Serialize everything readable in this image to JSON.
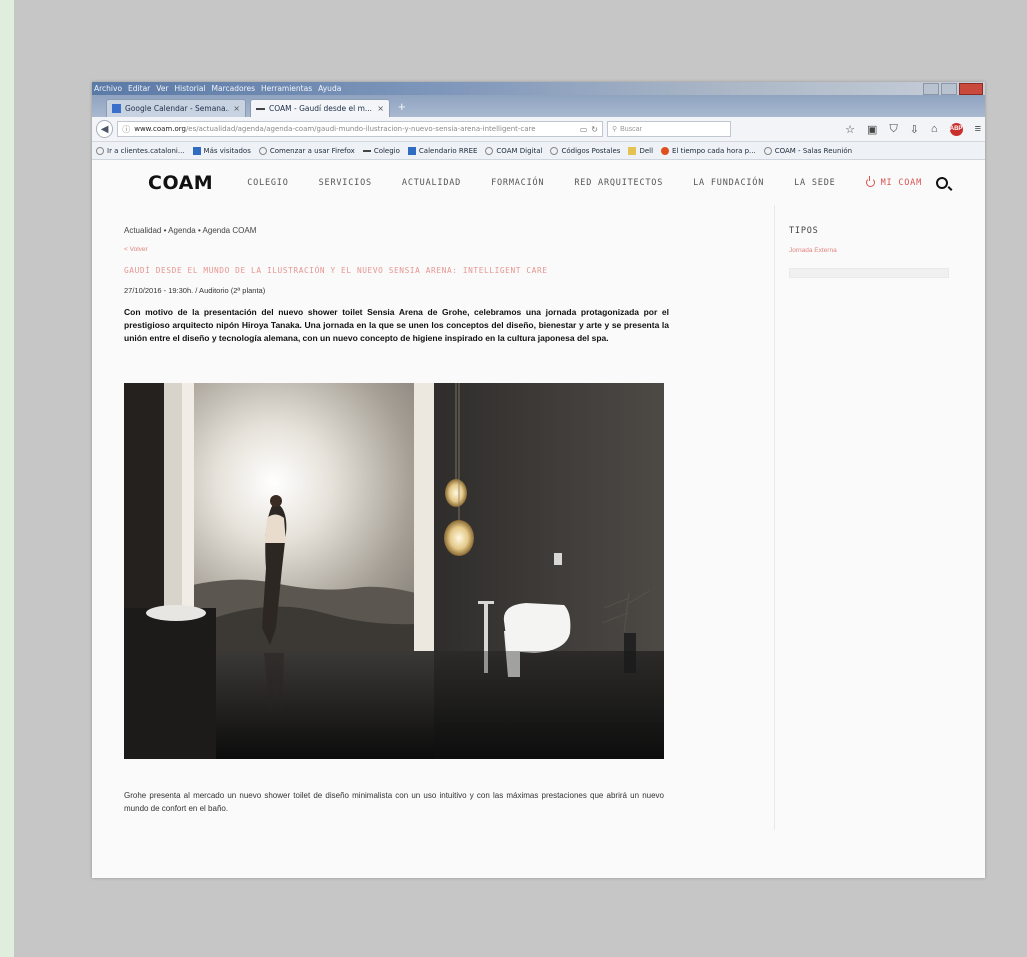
{
  "browser": {
    "menu": [
      "Archivo",
      "Editar",
      "Ver",
      "Historial",
      "Marcadores",
      "Herramientas",
      "Ayuda"
    ],
    "tabs": [
      {
        "label": "Google Calendar - Semana...",
        "active": false
      },
      {
        "label": "COAM - Gaudí desde el m...",
        "active": true
      }
    ],
    "new_tab": "+",
    "url_domain": "www.coam.org",
    "url_path": "/es/actualidad/agenda/agenda-coam/gaudi-mundo-ilustracion-y-nuevo-sensia-arena-intelligent-care",
    "search_placeholder": "Buscar",
    "bookmarks": [
      {
        "label": "Ir a clientes.cataloni...",
        "icon": "globe"
      },
      {
        "label": "Más visitados",
        "icon": "folder-blue"
      },
      {
        "label": "Comenzar a usar Firefox",
        "icon": "globe"
      },
      {
        "label": "Colegio",
        "icon": "dash"
      },
      {
        "label": "Calendario RREE",
        "icon": "calendar"
      },
      {
        "label": "COAM Digital",
        "icon": "globe"
      },
      {
        "label": "Códigos Postales",
        "icon": "globe"
      },
      {
        "label": "Dell",
        "icon": "folder-yellow"
      },
      {
        "label": "El tiempo cada hora p...",
        "icon": "weather"
      },
      {
        "label": "COAM - Salas Reunión",
        "icon": "globe"
      }
    ]
  },
  "site": {
    "logo": "COAM",
    "nav": [
      "COLEGIO",
      "SERVICIOS",
      "ACTUALIDAD",
      "FORMACIÓN",
      "RED ARQUITECTOS",
      "LA FUNDACIÓN",
      "LA SEDE"
    ],
    "mi_coam": "MI COAM",
    "accent": "#d9534f"
  },
  "article": {
    "breadcrumb": "Actualidad • Agenda • Agenda COAM",
    "back": "< Volver",
    "title": "GAUDÍ DESDE EL MUNDO DE LA ILUSTRACIÓN Y EL NUEVO SENSIA ARENA: INTELLIGENT CARE",
    "meta": "27/10/2016 - 19:30h. / Auditorio (2ª planta)",
    "lead": "Con motivo de la presentación del nuevo shower toilet Sensia Arena de Grohe, celebramos una jornada protagonizada por el prestigioso arquitecto nipón Hiroya Tanaka. Una jornada en la que se unen los conceptos del diseño, bienestar y arte y se presenta la unión entre el diseño y tecnología alemana, con un nuevo concepto de higiene inspirado en la cultura japonesa del spa.",
    "body": "Grohe presenta al mercado un nuevo shower toilet de diseño minimalista con un uso intuitivo y con las máximas prestaciones que abrirá un nuevo mundo de confort en el baño."
  },
  "sidebar": {
    "heading": "TIPOS",
    "link": "Jornada Externa"
  }
}
